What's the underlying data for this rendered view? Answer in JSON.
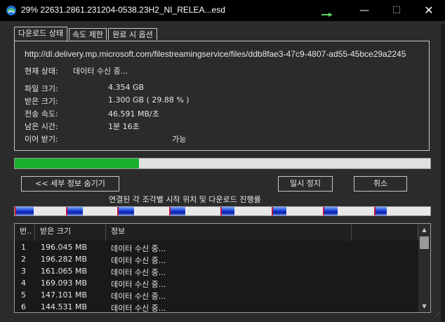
{
  "window": {
    "title": "29% 22631.2861.231204-0538.23H2_NI_RELEA...esd",
    "icon": "idm-download-icon",
    "controls": {
      "minimize": "—",
      "maximize": "☐",
      "close": "✕"
    }
  },
  "tabs": [
    {
      "label": "다운로드 상태",
      "active": true
    },
    {
      "label": "속도 제한",
      "active": false
    },
    {
      "label": "완료 시 옵션",
      "active": false
    }
  ],
  "status": {
    "url": "http://dl.delivery.mp.microsoft.com/filestreamingservice/files/ddb8fae3-47c9-4807-ad55-45bce29a2245",
    "state_label": "현재 상태:",
    "state_value": "데이터 수신 중...",
    "file_size_label": "파일 크기:",
    "file_size_value": "4.354  GB",
    "received_label": "받은 크기:",
    "received_value": "1.300  GB  ( 29.88 % )",
    "speed_label": "전송 속도:",
    "speed_value": "46.591  MB/초",
    "remaining_label": "남은 시간:",
    "remaining_value": "1분 16초",
    "resume_label": "이어 받기:",
    "resume_value": "가능"
  },
  "progress": {
    "percent": 29.88
  },
  "buttons": {
    "hide_details": "<< 세부 정보 숨기기",
    "pause": "일시 정지",
    "cancel": "취소"
  },
  "segments": {
    "caption": "연결된 각 조각별 시작 위치 및 다운로드 진행률",
    "starts": [
      0,
      0.1236,
      0.2472,
      0.3708,
      0.4944,
      0.618,
      0.7416,
      0.8652
    ],
    "filled": [
      0.045,
      0.04,
      0.04,
      0.04,
      0.035,
      0.035,
      0.035,
      0.03
    ]
  },
  "connections": {
    "columns": [
      "번..",
      "받은 크기",
      "정보",
      ""
    ],
    "rows": [
      {
        "n": "1",
        "received": "196.045  MB",
        "info": "데이터 수신 중..."
      },
      {
        "n": "2",
        "received": "196.282  MB",
        "info": "데이터 수신 중..."
      },
      {
        "n": "3",
        "received": "161.065  MB",
        "info": "데이터 수신 중..."
      },
      {
        "n": "4",
        "received": "169.093  MB",
        "info": "데이터 수신 중..."
      },
      {
        "n": "5",
        "received": "147.101  MB",
        "info": "데이터 수신 중..."
      },
      {
        "n": "6",
        "received": "144.531  MB",
        "info": "데이터 수신 중..."
      }
    ]
  },
  "colors": {
    "progress_fill": "#18b02e",
    "segment": "#1a3fd6",
    "segment_start": "#c0143c"
  }
}
